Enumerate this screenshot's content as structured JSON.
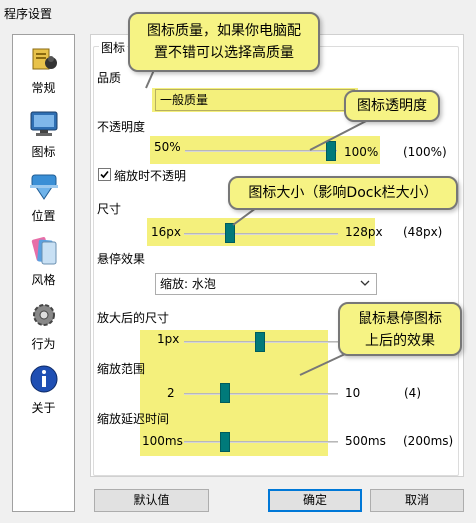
{
  "window": {
    "title": "程序设置"
  },
  "sidebar": {
    "items": [
      {
        "label": "常规",
        "icon": "general-settings-icon"
      },
      {
        "label": "图标",
        "icon": "monitor-icon"
      },
      {
        "label": "位置",
        "icon": "position-icon"
      },
      {
        "label": "风格",
        "icon": "style-icon"
      },
      {
        "label": "行为",
        "icon": "gear-icon"
      },
      {
        "label": "关于",
        "icon": "info-icon"
      }
    ]
  },
  "icons_panel": {
    "group_title": "图标",
    "quality": {
      "label": "品质",
      "value": "一般质量"
    },
    "opacity": {
      "label": "不透明度",
      "min": "50%",
      "max": "100%",
      "current": "(100%)",
      "level": 1.0
    },
    "opaque_on_zoom": {
      "label": "缩放时不透明",
      "checked": true
    },
    "size": {
      "label": "尺寸",
      "min": "16px",
      "max": "128px",
      "current": "(48px)",
      "level": 0.29
    },
    "hover_effect": {
      "label": "悬停效果",
      "value": "缩放: 水泡"
    },
    "zoom_size": {
      "label": "放大后的尺寸",
      "min": "1px",
      "level": 0.52
    },
    "zoom_range": {
      "label": "缩放范围",
      "min": "2",
      "max": "10",
      "current": "(4)",
      "level": 0.25
    },
    "zoom_delay": {
      "label": "缩放延迟时间",
      "min": "100ms",
      "max": "500ms",
      "current": "(200ms)",
      "level": 0.25
    }
  },
  "callouts": {
    "quality": "图标质量，如果你电脑配置不错可以选择高质量",
    "quality_line1": "图标质量，如果你电脑配",
    "quality_line2": "置不错可以选择高质量",
    "opacity": "图标透明度",
    "size": "图标大小（影响Dock栏大小）",
    "hover_line1": "鼠标悬停图标",
    "hover_line2": "上后的效果"
  },
  "buttons": {
    "defaults": "默认值",
    "ok": "确定",
    "cancel": "取消"
  },
  "colors": {
    "highlight": "#f4f07c",
    "slider_thumb": "#007a7a",
    "callout_bg": "#f6f384",
    "accent": "#0078d7"
  }
}
